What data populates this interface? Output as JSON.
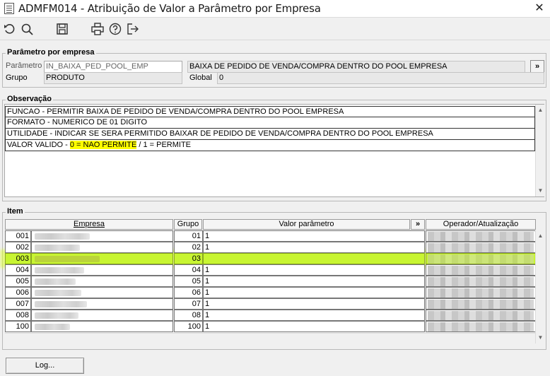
{
  "window": {
    "title": "ADMFM014 - Atribuição de Valor a Parâmetro por Empresa",
    "close_glyph": "✕"
  },
  "toolbar": {
    "icons": [
      "undo-icon",
      "search-icon",
      "save-icon",
      "print-icon",
      "help-icon",
      "exit-icon"
    ]
  },
  "parametro_por_empresa": {
    "legend": "Parâmetro por empresa",
    "parametro_label": "Parâmetro",
    "parametro_value": "IN_BAIXA_PED_POOL_EMP",
    "descricao_value": "BAIXA DE PEDIDO DE VENDA/COMPRA DENTRO DO POOL EMPRESA",
    "more_button": "»",
    "grupo_label": "Grupo",
    "grupo_value": "PRODUTO",
    "global_label": "Global",
    "global_value": "0"
  },
  "observacao": {
    "legend": "Observação",
    "lines": [
      "FUNCAO - PERMITIR BAIXA DE PEDIDO DE VENDA/COMPRA DENTRO DO POOL EMPRESA",
      "FORMATO - NUMERICO DE 01 DIGITO",
      "UTILIDADE - INDICAR SE SERA PERMITIDO BAIXAR DE PEDIDO DE VENDA/COMPRA DENTRO DO POOL EMPRESA"
    ],
    "valor_prefix": "VALOR VALIDO - ",
    "valor_highlight": "0 = NAO PERMITE",
    "valor_suffix": " / 1 = PERMITE"
  },
  "item": {
    "legend": "Item",
    "columns": {
      "empresa": "Empresa",
      "grupo": "Grupo",
      "valor": "Valor parâmetro",
      "more": "»",
      "operador": "Operador/Atualização"
    },
    "rows": [
      {
        "empresa": "001",
        "grupo": "01",
        "valor": "1"
      },
      {
        "empresa": "002",
        "grupo": "02",
        "valor": "1"
      },
      {
        "empresa": "003",
        "grupo": "03",
        "valor": ""
      },
      {
        "empresa": "004",
        "grupo": "04",
        "valor": "1"
      },
      {
        "empresa": "005",
        "grupo": "05",
        "valor": "1"
      },
      {
        "empresa": "006",
        "grupo": "06",
        "valor": "1"
      },
      {
        "empresa": "007",
        "grupo": "07",
        "valor": "1"
      },
      {
        "empresa": "008",
        "grupo": "08",
        "valor": "1"
      },
      {
        "empresa": "100",
        "grupo": "100",
        "valor": "1"
      }
    ],
    "selected_index": 2
  },
  "footer": {
    "log_label": "Log..."
  },
  "colors": {
    "highlight_yellow": "#ffff00",
    "selected_row": "#c8f532"
  }
}
